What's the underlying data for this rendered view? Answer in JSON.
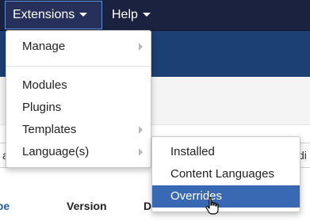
{
  "navbar": {
    "extensions_label": "Extensions",
    "help_label": "Help"
  },
  "extensions_menu": {
    "items": [
      {
        "label": "Manage",
        "has_submenu": true
      },
      {
        "label": "Modules",
        "has_submenu": false
      },
      {
        "label": "Plugins",
        "has_submenu": false
      },
      {
        "label": "Templates",
        "has_submenu": true
      },
      {
        "label": "Language(s)",
        "has_submenu": true
      }
    ]
  },
  "language_submenu": {
    "items": [
      {
        "label": "Installed"
      },
      {
        "label": "Content Languages"
      },
      {
        "label": "Overrides",
        "highlighted": true
      }
    ]
  },
  "filter_bar": {
    "left_button_fragment": "a",
    "right_button_fragment": "di"
  },
  "table_header": {
    "col_type": "ype",
    "col_version": "Version",
    "col_date_fragment": "D"
  },
  "colors": {
    "navbar": "#1b2240",
    "subhead": "#1c3f74",
    "highlight": "#3a69b4",
    "link": "#1f5ea8"
  }
}
